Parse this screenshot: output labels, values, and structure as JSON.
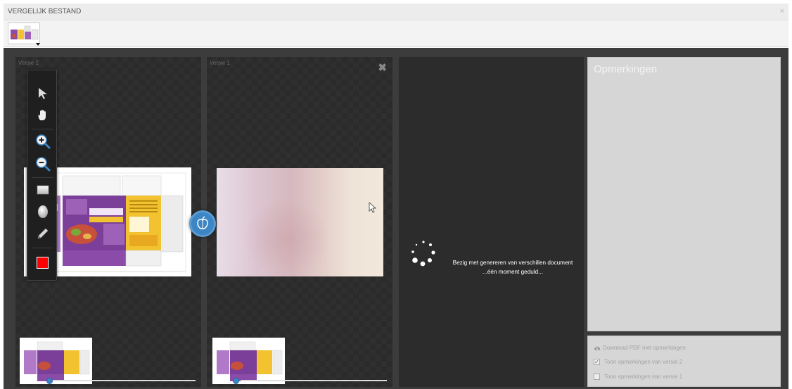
{
  "window": {
    "title": "VERGELIJK BESTAND",
    "close_glyph": "×"
  },
  "thumbstrip": {
    "thumb_icon": "document-thumbnail-icon",
    "dropdown_icon": "caret-down-icon"
  },
  "panels": {
    "left": {
      "label": "Versie 2"
    },
    "right": {
      "label": "Versie 1",
      "close_glyph": "✖"
    }
  },
  "toolbar": {
    "tools": [
      "select-arrow-icon",
      "pan-hand-icon",
      "zoom-in-icon",
      "zoom-out-icon",
      "rectangle-icon",
      "ellipse-icon",
      "pencil-icon",
      "color-swatch-icon"
    ],
    "color": "#ff0000"
  },
  "compare_button": {
    "icon": "compare-apples-icon",
    "color": "#3d86c6"
  },
  "diff": {
    "status_line1": "Bezig met genereren van verschillen document",
    "status_line2": "...één moment geduld..."
  },
  "remarks": {
    "title": "Opmerkingen",
    "download_label": "Download PDF met opmerkingen",
    "show_v2_label": "Toon opmerkingen van versie 2",
    "show_v2_checked": true,
    "show_v1_label": "Toon opmerkingen van versie 1",
    "show_v1_checked": false
  },
  "colors": {
    "accent": "#3d86c6",
    "packaging_purple": "#7b3f9a",
    "packaging_yellow": "#f2c230"
  }
}
